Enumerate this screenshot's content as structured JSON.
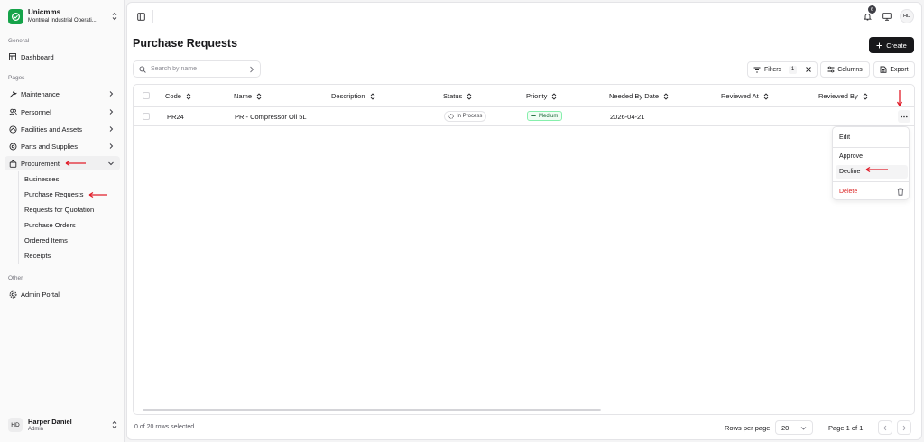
{
  "org": {
    "name": "Unicmms",
    "subtitle": "Montreal Industrial Operati..."
  },
  "sidebar": {
    "general_label": "General",
    "pages_label": "Pages",
    "other_label": "Other",
    "dashboard": "Dashboard",
    "items": [
      {
        "label": "Maintenance"
      },
      {
        "label": "Personnel"
      },
      {
        "label": "Facilities and Assets"
      },
      {
        "label": "Parts and Supplies"
      },
      {
        "label": "Procurement"
      }
    ],
    "procurement_sub": [
      {
        "label": "Businesses"
      },
      {
        "label": "Purchase Requests"
      },
      {
        "label": "Requests for Quotation"
      },
      {
        "label": "Purchase Orders"
      },
      {
        "label": "Ordered Items"
      },
      {
        "label": "Receipts"
      }
    ],
    "admin_portal": "Admin Portal"
  },
  "user": {
    "initials": "HD",
    "name": "Harper Daniel",
    "role": "Admin"
  },
  "topbar": {
    "notification_count": "6",
    "avatar_initials": "HD"
  },
  "page": {
    "title": "Purchase Requests",
    "create_label": "Create"
  },
  "toolbar": {
    "search_placeholder": "Search by name",
    "filters_label": "Filters",
    "filters_count": "1",
    "columns_label": "Columns",
    "export_label": "Export"
  },
  "table": {
    "headers": [
      "Code",
      "Name",
      "Description",
      "Status",
      "Priority",
      "Needed By Date",
      "Reviewed At",
      "Reviewed By"
    ],
    "rows": [
      {
        "code": "PR24",
        "name": "PR - Compressor Oil 5L",
        "description": "",
        "status": "In Process",
        "priority": "Medium",
        "needed_by": "2026-04-21",
        "reviewed_at": "",
        "reviewed_by": ""
      }
    ]
  },
  "row_menu": {
    "edit": "Edit",
    "approve": "Approve",
    "decline": "Decline",
    "delete": "Delete"
  },
  "footer": {
    "selected": "0 of 20 rows selected.",
    "rows_per_page_label": "Rows per page",
    "rows_per_page_value": "20",
    "page_info": "Page 1 of 1"
  },
  "colors": {
    "brand": "#16a34a",
    "annotation": "#e11d2a",
    "danger": "#dc2626",
    "priority": "#166534"
  },
  "icons": [
    "logo-icon",
    "chevrons-updown-icon",
    "dashboard-icon",
    "wrench-icon",
    "users-icon",
    "building-icon",
    "box-icon",
    "bag-icon",
    "chevron-right-icon",
    "chevron-down-icon",
    "settings-icon",
    "sidebar-toggle-icon",
    "bell-icon",
    "monitor-icon",
    "plus-icon",
    "search-icon",
    "filter-icon",
    "close-icon",
    "columns-icon",
    "export-icon",
    "sort-icon",
    "loader-icon",
    "ellipsis-icon",
    "trash-icon",
    "chevron-left-icon"
  ]
}
